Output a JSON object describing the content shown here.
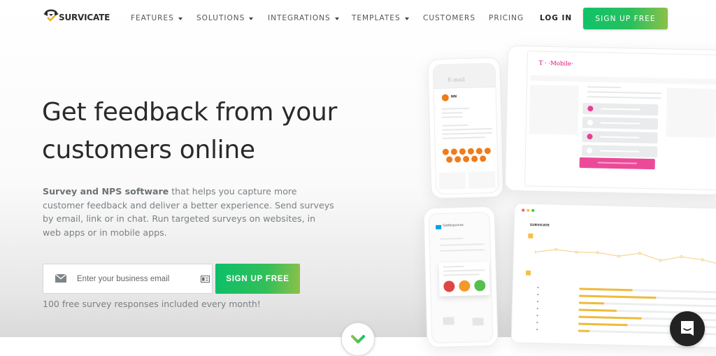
{
  "brand": {
    "name": "SURVICATE",
    "accent_color": "#f5a623",
    "cta_gradient": [
      "#11c268",
      "#8cc04a"
    ]
  },
  "nav": {
    "items": [
      {
        "label": "FEATURES",
        "has_dropdown": true
      },
      {
        "label": "SOLUTIONS",
        "has_dropdown": true
      },
      {
        "label": "INTEGRATIONS",
        "has_dropdown": true
      },
      {
        "label": "TEMPLATES",
        "has_dropdown": true
      },
      {
        "label": "CUSTOMERS",
        "has_dropdown": false
      },
      {
        "label": "PRICING",
        "has_dropdown": false
      }
    ],
    "login_label": "LOG IN",
    "cta_label": "SIGN UP FREE"
  },
  "hero": {
    "headline_line1": "Get feedback from your",
    "headline_line2": "customers online",
    "description_bold": "Survey and NPS software",
    "description_rest": " that helps you capture more customer feedback and deliver a better experience. Send surveys by email, link or in chat. Run targeted surveys on websites, in web apps or in mobile apps.",
    "email_placeholder": "Enter your business email",
    "email_value": "",
    "cta_label": "SIGN UP FREE",
    "note": "100 free survey responses included every month!"
  },
  "illustration": {
    "phone_email": {
      "header_title": "E-mail",
      "brand": "NN",
      "nps_scale_count": 11,
      "nps_color": "#f07b1a"
    },
    "tablet": {
      "brand": "T · ·Mobile·",
      "brand_color": "#e2007a",
      "options": [
        true,
        false,
        true,
        false
      ],
      "submit_color": "#ec4a99"
    },
    "phone_web": {
      "brand": "GetResponse",
      "faces": [
        "sad",
        "neutral",
        "happy"
      ]
    },
    "dashboard": {
      "brand": "SURVICATE",
      "line_points": [
        0.55,
        0.7,
        0.6,
        0.6,
        0.45,
        0.62,
        0.3,
        0.5,
        0.38,
        0.15
      ],
      "bars": [
        0.38,
        0.55,
        0.18,
        0.27,
        0.45,
        0.35,
        0.08
      ]
    }
  },
  "widgets": {
    "scroll_down": "chevron-down",
    "chat": "intercom-chat"
  }
}
